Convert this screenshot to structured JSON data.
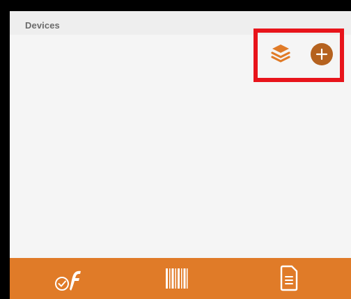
{
  "section": {
    "title": "Devices"
  },
  "toolbar": {
    "layers_icon": "layers-icon",
    "add_icon": "add-circle-icon",
    "highlight_color": "#e8141b"
  },
  "bottom_nav": {
    "items": [
      {
        "icon": "wrench-check-icon"
      },
      {
        "icon": "barcode-icon"
      },
      {
        "icon": "document-list-icon"
      }
    ]
  },
  "colors": {
    "accent": "#e07b28",
    "add_button": "#b5621f",
    "header_bg": "#eeeeee",
    "content_bg": "#f5f5f5"
  }
}
